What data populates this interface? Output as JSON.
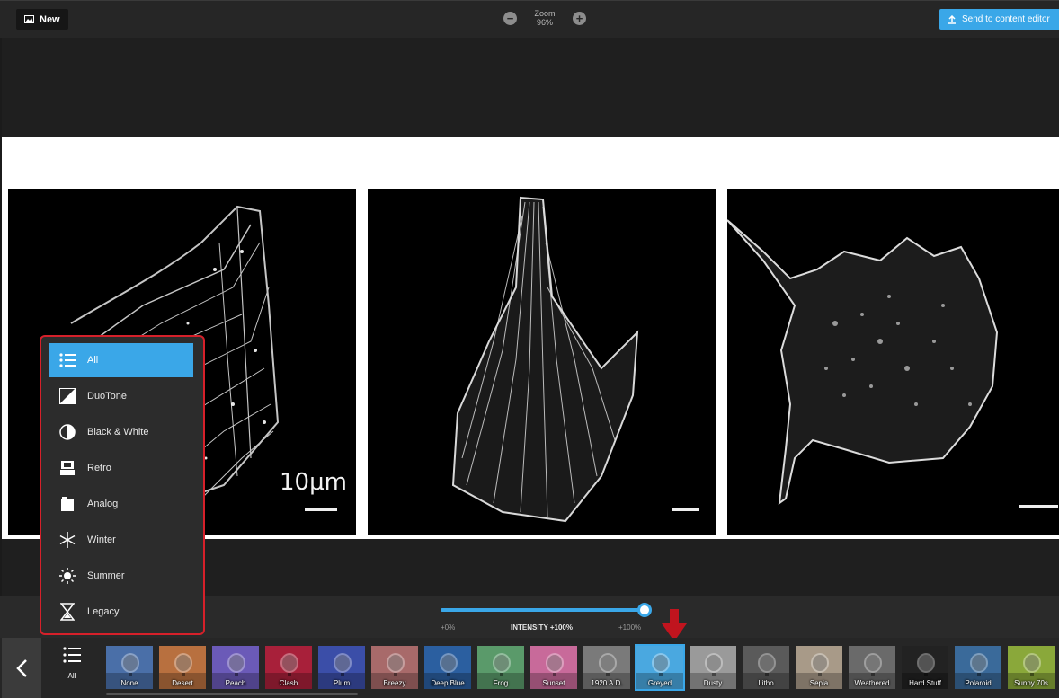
{
  "toolbar": {
    "new_label": "New",
    "zoom_label": "Zoom",
    "zoom_value": "96%",
    "send_label": "Send to content editor"
  },
  "image": {
    "scale_label": "10μm"
  },
  "intensity": {
    "min_label": "+0%",
    "label": "INTENSITY +100%",
    "max_label": "+100%",
    "value": 1.0
  },
  "categories": [
    {
      "label": "All",
      "icon": "list-icon",
      "active": true
    },
    {
      "label": "DuoTone",
      "icon": "duotone-icon"
    },
    {
      "label": "Black & White",
      "icon": "contrast-icon"
    },
    {
      "label": "Retro",
      "icon": "retro-icon"
    },
    {
      "label": "Analog",
      "icon": "analog-icon"
    },
    {
      "label": "Winter",
      "icon": "snowflake-icon"
    },
    {
      "label": "Summer",
      "icon": "sun-icon"
    },
    {
      "label": "Legacy",
      "icon": "hourglass-icon"
    }
  ],
  "filterbar": {
    "all_label": "All",
    "filters": [
      {
        "label": "None",
        "color": "#4a6fa8"
      },
      {
        "label": "Desert",
        "color": "#b8703f"
      },
      {
        "label": "Peach",
        "color": "#6b5ab8"
      },
      {
        "label": "Clash",
        "color": "#a8203a"
      },
      {
        "label": "Plum",
        "color": "#3b4ea8"
      },
      {
        "label": "Breezy",
        "color": "#a86a6a"
      },
      {
        "label": "Deep Blue",
        "color": "#2b5fa0"
      },
      {
        "label": "Frog",
        "color": "#5a9a6a"
      },
      {
        "label": "Sunset",
        "color": "#c86a9a"
      },
      {
        "label": "1920 A.D.",
        "color": "#7a7a7a"
      },
      {
        "label": "Greyed",
        "color": "#4aa8e0",
        "selected": true
      },
      {
        "label": "Dusty",
        "color": "#9a9a9a"
      },
      {
        "label": "Litho",
        "color": "#5a5a5a"
      },
      {
        "label": "Sepia",
        "color": "#a89a88"
      },
      {
        "label": "Weathered",
        "color": "#6a6a6a"
      },
      {
        "label": "Hard Stuff",
        "color": "#222222"
      },
      {
        "label": "Polaroid",
        "color": "#3a6a9a"
      },
      {
        "label": "Sunny 70s",
        "color": "#8aa83a"
      }
    ]
  },
  "colors": {
    "accent": "#3aa7e8",
    "highlight_border": "#d6202a"
  }
}
